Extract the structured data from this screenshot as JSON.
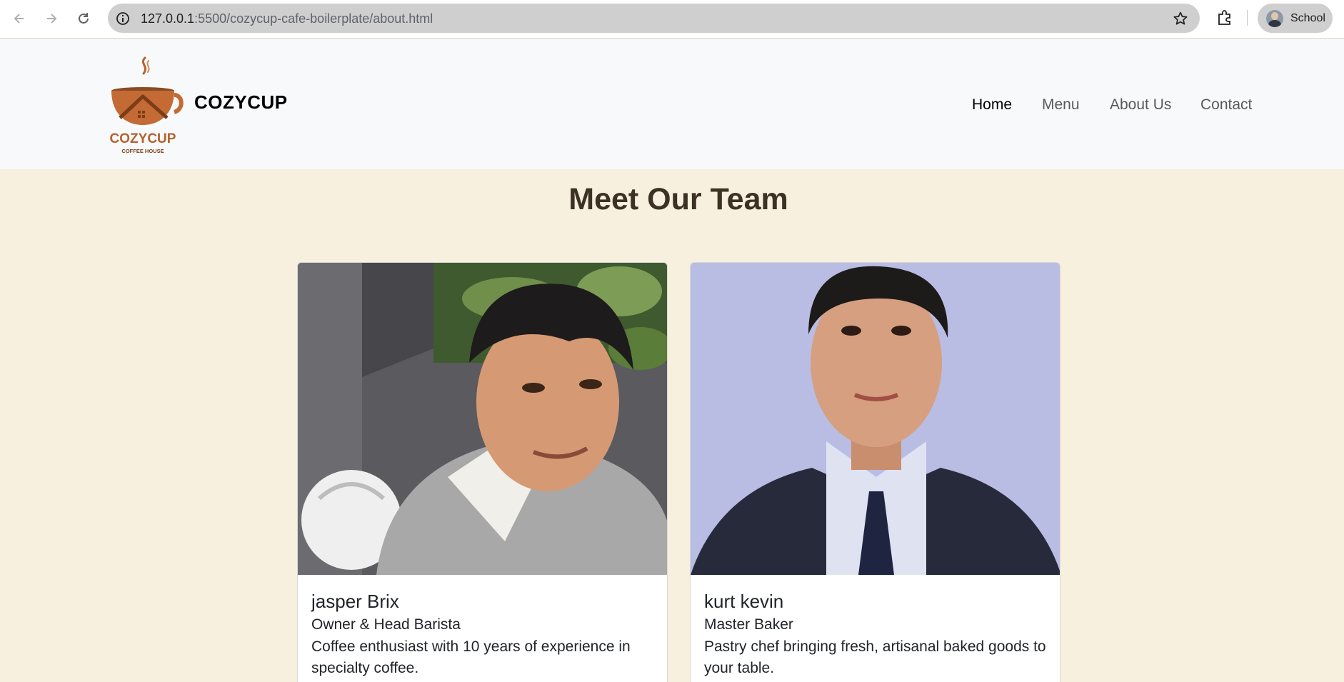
{
  "browser": {
    "url_host": "127.0.0.1",
    "url_rest": ":5500/cozycup-cafe-boilerplate/about.html",
    "profile_label": "School"
  },
  "site": {
    "brand": "COZYCUP",
    "logo_text": "COZYCUP",
    "logo_subtext": "COFFEE HOUSE",
    "nav": [
      {
        "label": "Home",
        "active": true
      },
      {
        "label": "Menu",
        "active": false
      },
      {
        "label": "About Us",
        "active": false
      },
      {
        "label": "Contact",
        "active": false
      }
    ]
  },
  "main": {
    "title": "Meet Our Team",
    "team": [
      {
        "name": "jasper Brix",
        "role": "Owner & Head Barista",
        "bio": "Coffee enthusiast with 10 years of experience in specialty coffee."
      },
      {
        "name": "kurt kevin",
        "role": "Master Baker",
        "bio": "Pastry chef bringing fresh, artisanal baked goods to your table."
      }
    ]
  },
  "colors": {
    "page_background": "#f8f0df",
    "header_background": "#f8f9fa",
    "title_color": "#3d3025",
    "logo_brown": "#b5622e"
  }
}
